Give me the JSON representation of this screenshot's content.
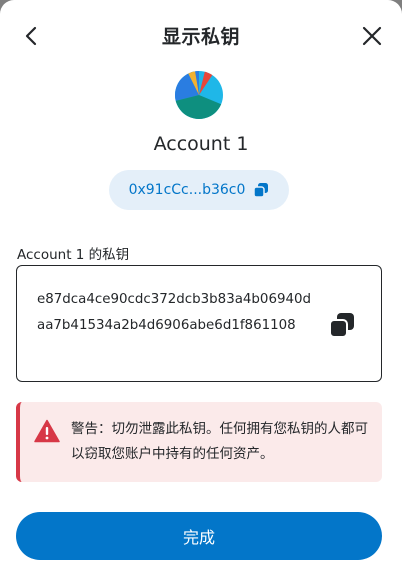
{
  "header": {
    "title": "显示私钥"
  },
  "account": {
    "name": "Account 1",
    "address": "0x91cCc...b36c0"
  },
  "private_key": {
    "label": "Account 1 的私钥",
    "value": "e87dca4ce90cdc372dcb3b83a4b06940daa7b41534a2b4d6906abe6d1f861108"
  },
  "warning": {
    "text": "警告：切勿泄露此私钥。任何拥有您私钥的人都可以窃取您账户中持有的任何资产。"
  },
  "footer": {
    "done_label": "完成"
  },
  "colors": {
    "primary": "#0376c9",
    "danger": "#d73847",
    "danger_bg": "#fbeaea",
    "pill_bg": "#e4eff9",
    "text": "#24272a"
  },
  "icons": [
    "back-arrow-icon",
    "close-icon",
    "copy-icon",
    "warning-icon"
  ]
}
